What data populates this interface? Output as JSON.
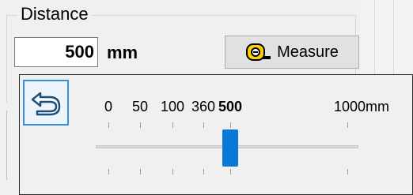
{
  "distance_group": {
    "title": "Distance",
    "value": "500",
    "unit": "mm",
    "measure_label": "Measure"
  },
  "scale_popup": {
    "back_icon": "back-arrow-icon",
    "ticks": [
      {
        "label": "0",
        "bold": false
      },
      {
        "label": "50",
        "bold": false
      },
      {
        "label": "100",
        "bold": false
      },
      {
        "label": "360",
        "bold": false
      },
      {
        "label": "500",
        "bold": true
      },
      {
        "label": "1000mm",
        "bold": false
      }
    ],
    "selected_index": 4,
    "colors": {
      "accent": "#0a78d7",
      "focus_border": "#3b8fd6"
    }
  }
}
